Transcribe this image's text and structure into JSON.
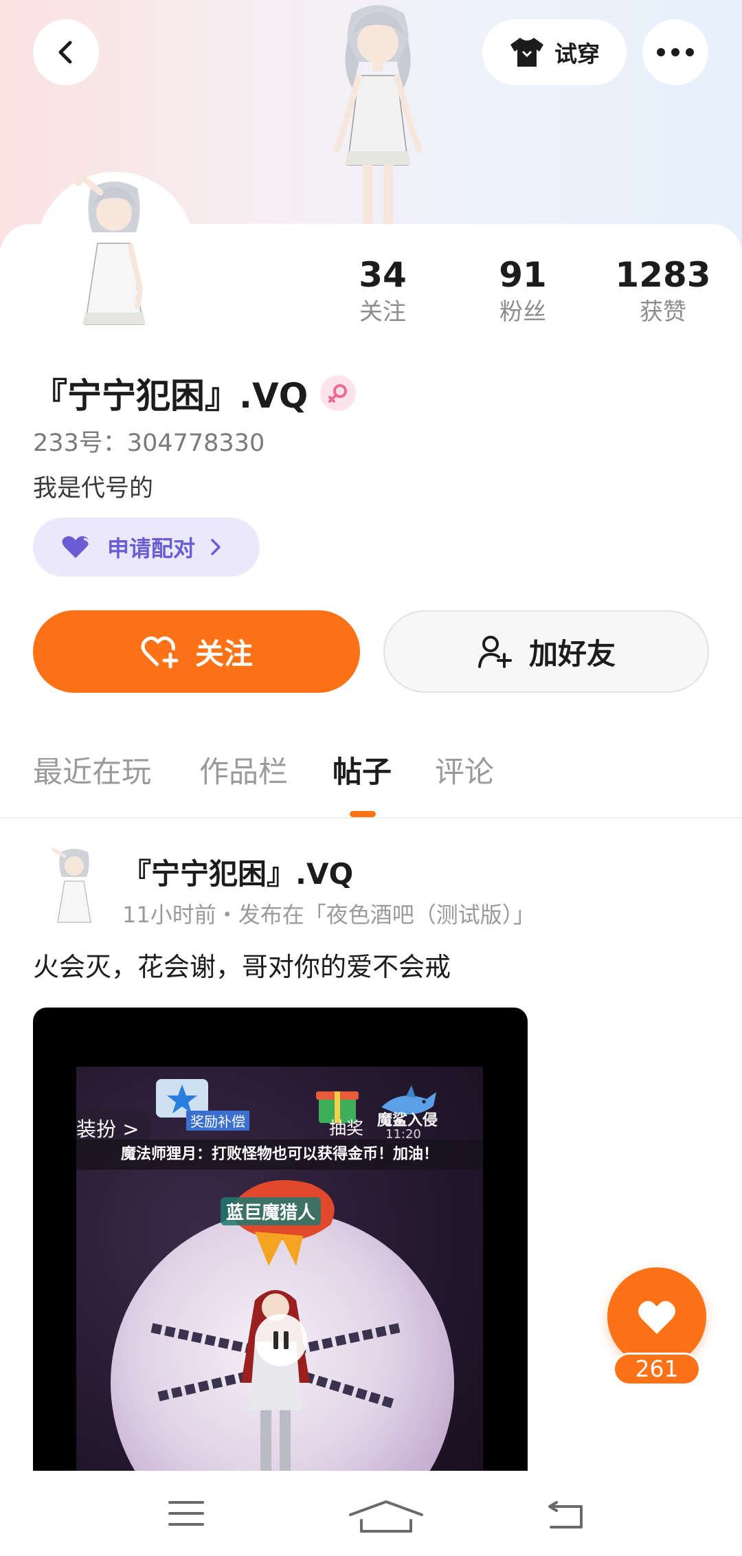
{
  "header": {
    "back_icon": "chevron-left-icon",
    "tryon_label": "试穿",
    "tryon_icon": "tshirt-icon",
    "more_icon": "more-dots-icon"
  },
  "profile": {
    "stats": [
      {
        "value": "34",
        "label": "关注"
      },
      {
        "value": "91",
        "label": "粉丝"
      },
      {
        "value": "1283",
        "label": "获赞"
      }
    ],
    "username": "『宁宁犯困』.VQ",
    "gender_icon": "female-symbol-icon",
    "uid": "233号：304778330",
    "bio": "我是代号的",
    "pair_label": "申请配对",
    "follow_label": "关注",
    "add_friend_label": "加好友"
  },
  "tabs": [
    {
      "label": "最近在玩",
      "active": false
    },
    {
      "label": "作品栏",
      "active": false
    },
    {
      "label": "帖子",
      "active": true
    },
    {
      "label": "评论",
      "active": false
    }
  ],
  "post": {
    "author": "『宁宁犯困』.VQ",
    "meta": "11小时前・发布在「夜色酒吧（测试版）」",
    "text": "火会灭，花会谢，哥对你的爱不会戒",
    "video": {
      "left_text": "装扮 >",
      "reward_label": "奖励补偿",
      "draw_label": "抽奖",
      "shark_label": "魔鲨入侵",
      "time": "11:20",
      "notice": "魔法师狸月：打败怪物也可以获得金币！加油！",
      "enemy_label": "蓝巨魔猎人",
      "state": "playing"
    }
  },
  "like": {
    "count": "261"
  },
  "colors": {
    "accent": "#fd7216",
    "pair_bg": "#ece8fc",
    "pair_text": "#6a5dd4"
  }
}
